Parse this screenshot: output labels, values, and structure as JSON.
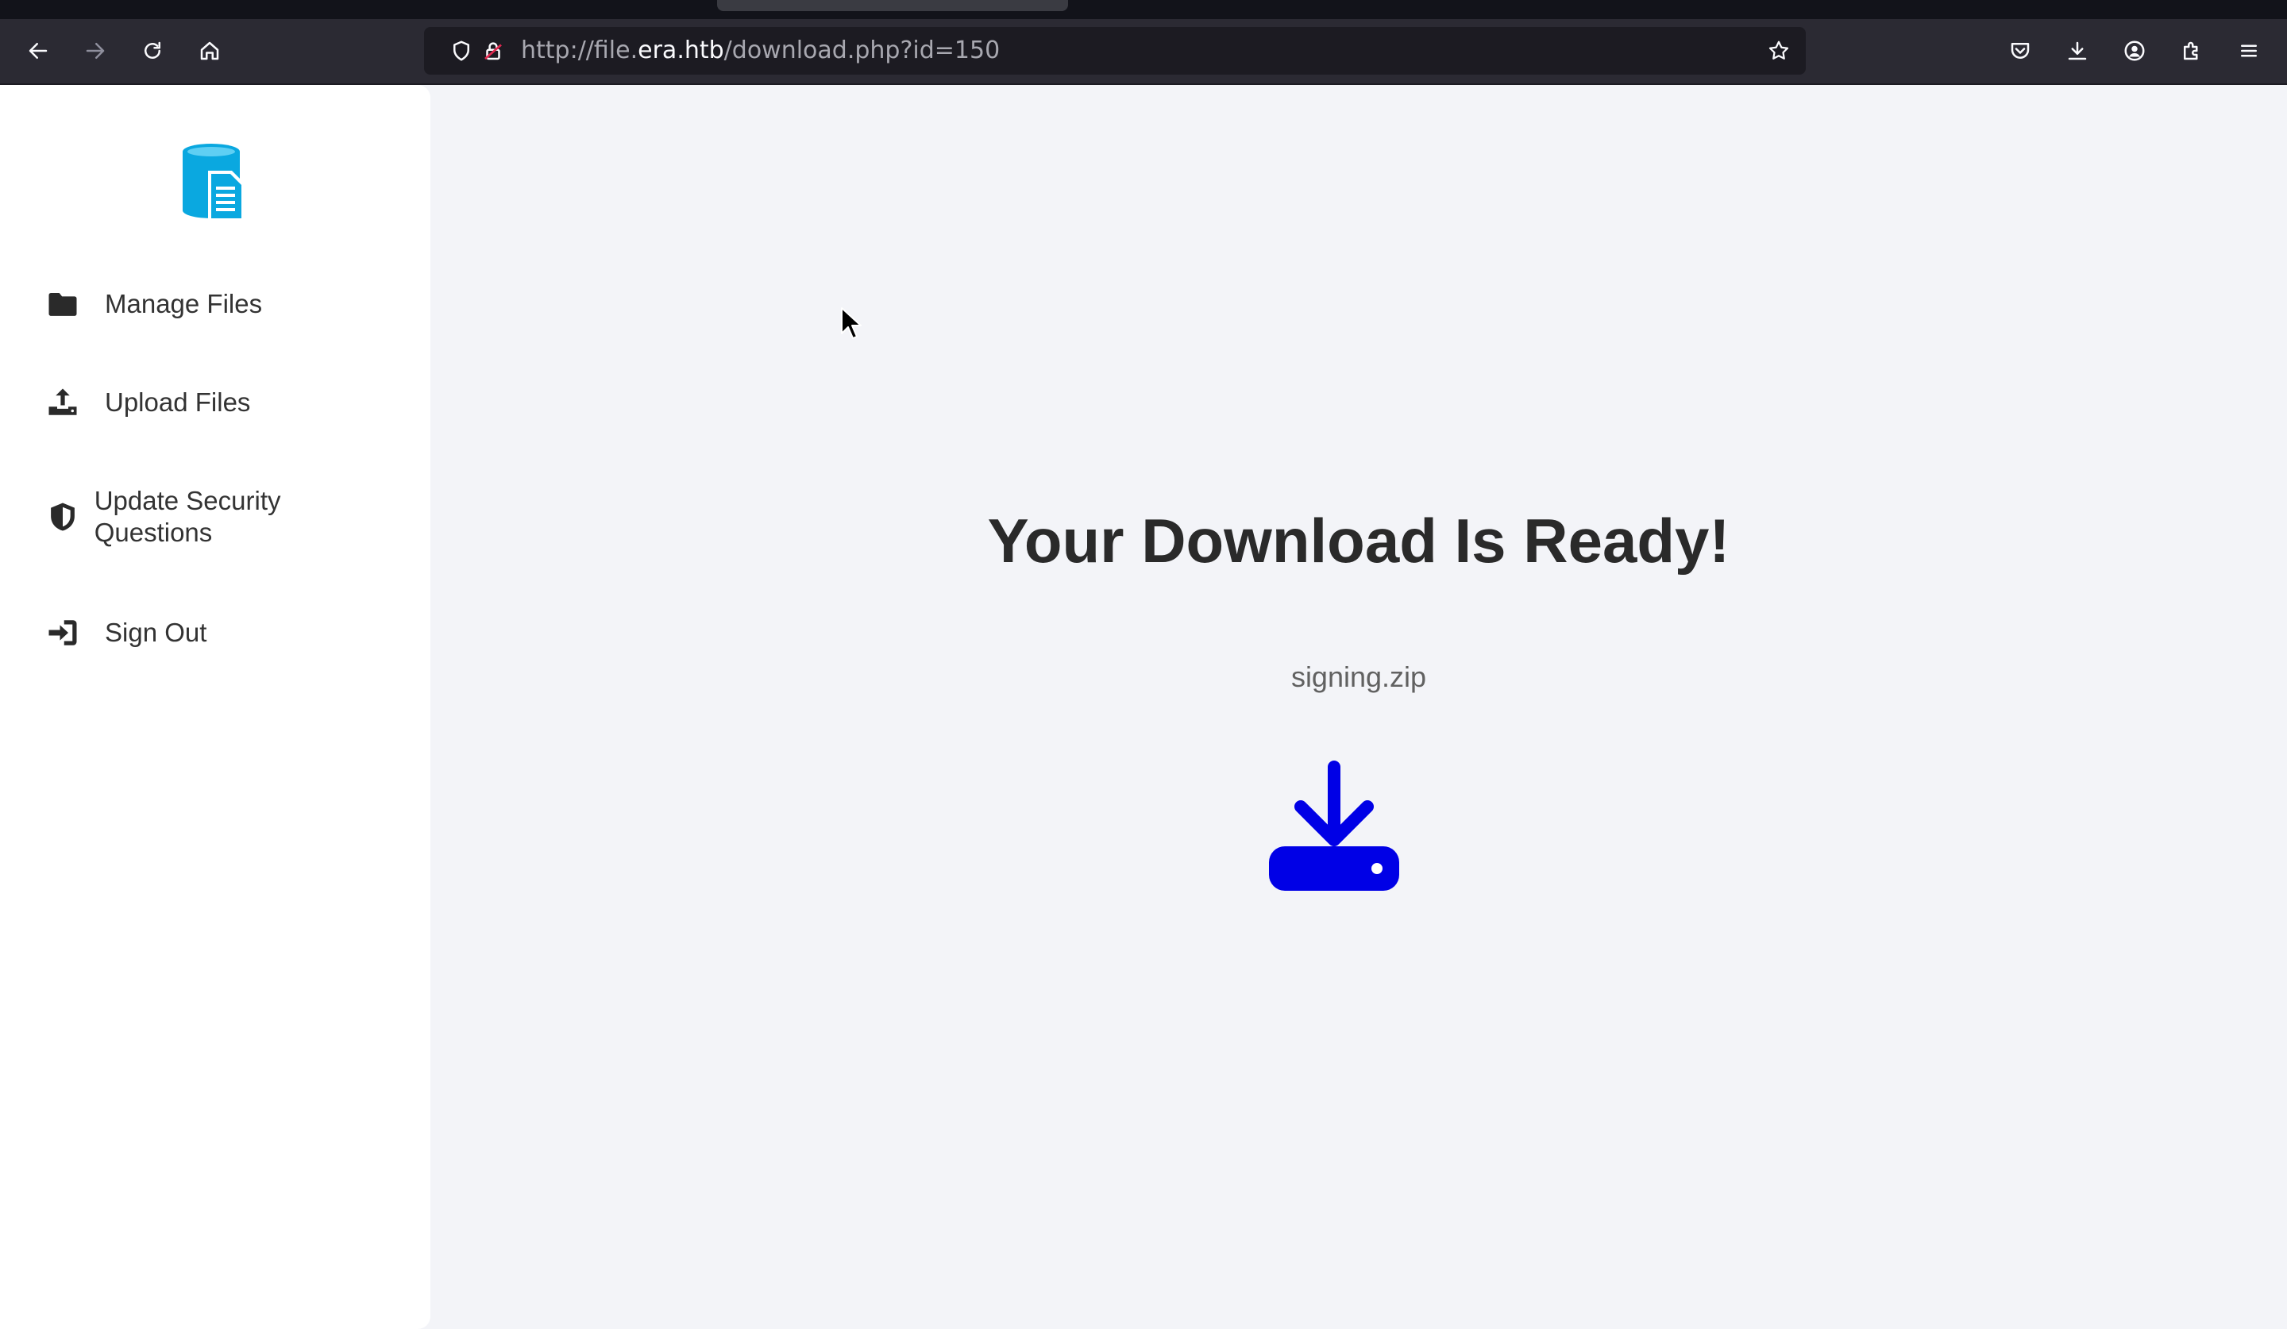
{
  "browser": {
    "url_prefix": "http://file.",
    "url_host": "era.htb",
    "url_path": "/download.php?id=150"
  },
  "sidebar": {
    "items": [
      {
        "label": "Manage Files",
        "icon": "folder-icon"
      },
      {
        "label": "Upload Files",
        "icon": "upload-icon"
      },
      {
        "label": "Update Security Questions",
        "icon": "shield-icon"
      },
      {
        "label": "Sign Out",
        "icon": "sign-out-icon"
      }
    ]
  },
  "main": {
    "title": "Your Download Is Ready!",
    "filename": "signing.zip"
  },
  "colors": {
    "accent_logo": "#0aa8e0",
    "download_icon": "#0000e6",
    "sidebar_bg": "#ffffff",
    "page_bg": "#f3f4f8"
  }
}
